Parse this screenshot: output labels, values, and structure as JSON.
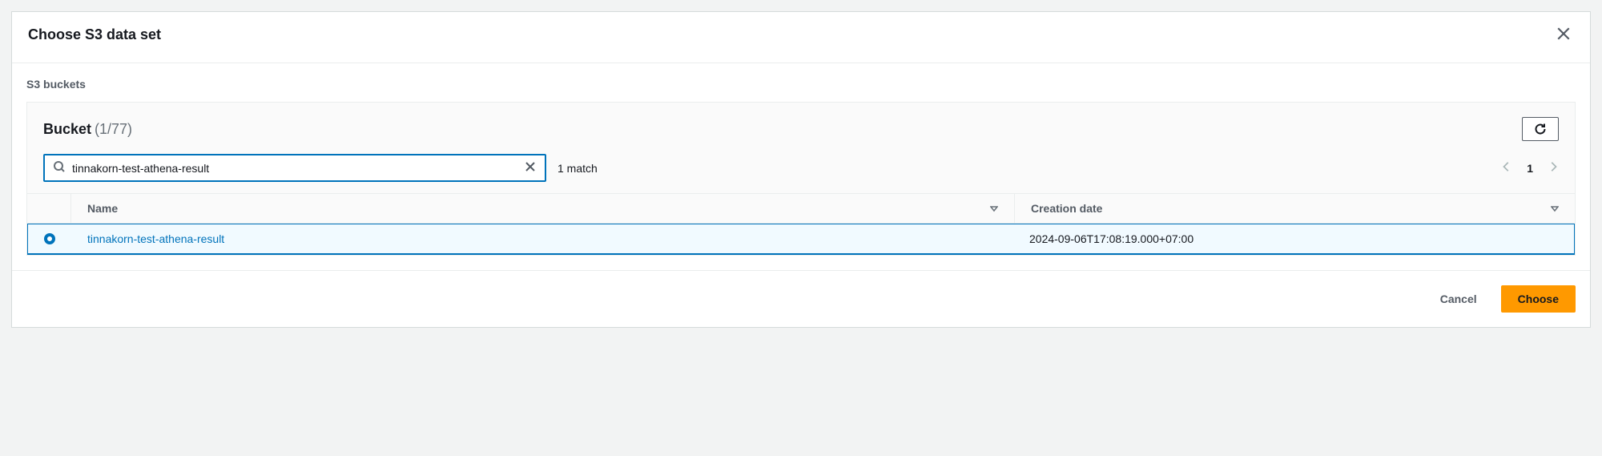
{
  "modal": {
    "title": "Choose S3 data set"
  },
  "breadcrumb": "S3 buckets",
  "panel": {
    "title": "Bucket",
    "count": "(1/77)"
  },
  "search": {
    "value": "tinnakorn-test-athena-result",
    "match_text": "1 match"
  },
  "pagination": {
    "current": "1"
  },
  "table": {
    "headers": {
      "name": "Name",
      "date": "Creation date"
    },
    "rows": [
      {
        "name": "tinnakorn-test-athena-result",
        "date": "2024-09-06T17:08:19.000+07:00"
      }
    ]
  },
  "footer": {
    "cancel": "Cancel",
    "choose": "Choose"
  }
}
